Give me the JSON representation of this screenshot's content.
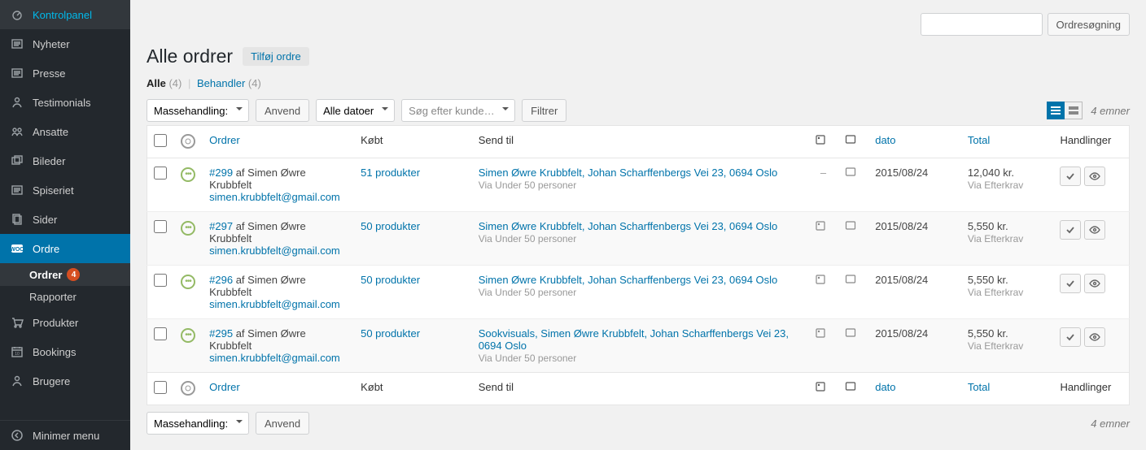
{
  "sidebar": {
    "items": [
      {
        "label": "Kontrolpanel",
        "icon": "gauge"
      },
      {
        "label": "Nyheter",
        "icon": "list"
      },
      {
        "label": "Presse",
        "icon": "list"
      },
      {
        "label": "Testimonials",
        "icon": "person"
      },
      {
        "label": "Ansatte",
        "icon": "team"
      },
      {
        "label": "Bileder",
        "icon": "images"
      },
      {
        "label": "Spiseriet",
        "icon": "list"
      },
      {
        "label": "Sider",
        "icon": "copy"
      },
      {
        "label": "Ordre",
        "icon": "woo",
        "current": true
      }
    ],
    "sub": [
      {
        "label": "Ordrer",
        "badge": "4",
        "current": true
      },
      {
        "label": "Rapporter"
      }
    ],
    "after": [
      {
        "label": "Produkter",
        "icon": "cart"
      },
      {
        "label": "Bookings",
        "icon": "calendar"
      },
      {
        "label": "Brugere",
        "icon": "person"
      }
    ],
    "collapse": "Minimer menu"
  },
  "page": {
    "title": "Alle ordrer",
    "add_button": "Tilføj ordre"
  },
  "status_links": {
    "all_label": "Alle",
    "all_count": "(4)",
    "processing_label": "Behandler",
    "processing_count": "(4)"
  },
  "search": {
    "button": "Ordresøgning"
  },
  "toolbar": {
    "bulk_label": "Massehandling:",
    "apply": "Anvend",
    "date_filter": "Alle datoer",
    "customer_placeholder": "Søg efter kunde…",
    "filter": "Filtrer",
    "item_count": "4 emner"
  },
  "columns": {
    "order": "Ordrer",
    "bought": "Købt",
    "ship_to": "Send til",
    "date": "dato",
    "total": "Total",
    "actions": "Handlinger"
  },
  "rows": [
    {
      "status": "processing",
      "order_link": "#299",
      "order_by": " af Simen Øwre Krubbfelt",
      "email": "simen.krubbfelt@gmail.com",
      "bought": "51 produkter",
      "ship_to": "Simen Øwre Krubbfelt, Johan Scharffenbergs Vei 23, 0694 Oslo",
      "ship_via": "Via Under 50 personer",
      "note": "–",
      "date": "2015/08/24",
      "total": "12,040 kr.",
      "total_via": "Via Efterkrav"
    },
    {
      "status": "processing",
      "order_link": "#297",
      "order_by": " af Simen Øwre Krubbfelt",
      "email": "simen.krubbfelt@gmail.com",
      "bought": "50 produkter",
      "ship_to": "Simen Øwre Krubbfelt, Johan Scharffenbergs Vei 23, 0694 Oslo",
      "ship_via": "Via Under 50 personer",
      "note": "icon",
      "date": "2015/08/24",
      "total": "5,550 kr.",
      "total_via": "Via Efterkrav"
    },
    {
      "status": "processing",
      "order_link": "#296",
      "order_by": " af Simen Øwre Krubbfelt",
      "email": "simen.krubbfelt@gmail.com",
      "bought": "50 produkter",
      "ship_to": "Simen Øwre Krubbfelt, Johan Scharffenbergs Vei 23, 0694 Oslo",
      "ship_via": "Via Under 50 personer",
      "note": "icon",
      "date": "2015/08/24",
      "total": "5,550 kr.",
      "total_via": "Via Efterkrav"
    },
    {
      "status": "processing",
      "order_link": "#295",
      "order_by": " af Simen Øwre Krubbfelt",
      "email": "simen.krubbfelt@gmail.com",
      "bought": "50 produkter",
      "ship_to": "Sookvisuals, Simen Øwre Krubbfelt, Johan Scharffenbergs Vei 23, 0694 Oslo",
      "ship_via": "Via Under 50 personer",
      "note": "icon",
      "date": "2015/08/24",
      "total": "5,550 kr.",
      "total_via": "Via Efterkrav"
    }
  ]
}
